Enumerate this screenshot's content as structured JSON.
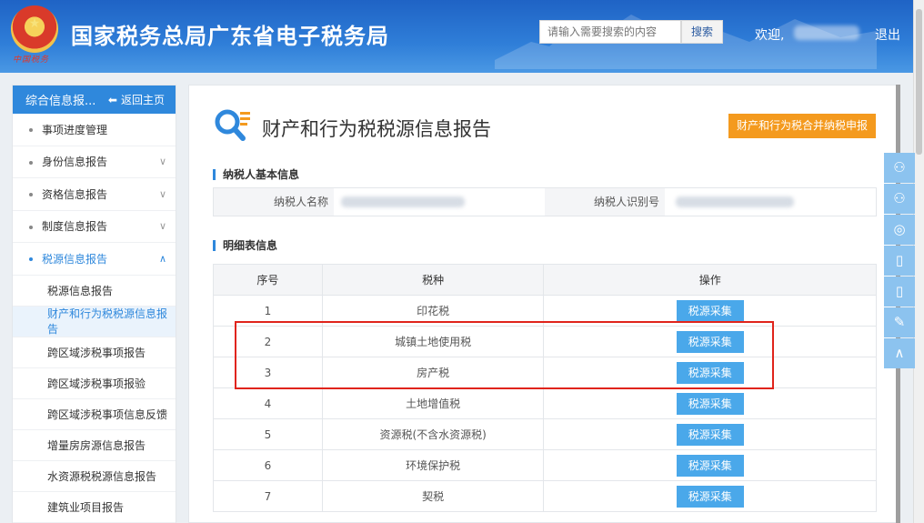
{
  "header": {
    "site_title": "国家税务总局广东省电子税务局",
    "emblem_text": "中国税务",
    "search_placeholder": "请输入需要搜索的内容",
    "search_button": "搜索",
    "welcome": "欢迎,",
    "logout": "退出"
  },
  "sidebar": {
    "title": "综合信息报...",
    "home_link": "返回主页",
    "items": [
      {
        "label": "事项进度管理",
        "expandable": false
      },
      {
        "label": "身份信息报告",
        "expandable": true,
        "expanded": false
      },
      {
        "label": "资格信息报告",
        "expandable": true,
        "expanded": false
      },
      {
        "label": "制度信息报告",
        "expandable": true,
        "expanded": false
      },
      {
        "label": "税源信息报告",
        "expandable": true,
        "expanded": true
      }
    ],
    "subitems": [
      {
        "label": "税源信息报告",
        "selected": false
      },
      {
        "label": "财产和行为税税源信息报告",
        "selected": true
      },
      {
        "label": "跨区域涉税事项报告",
        "selected": false
      },
      {
        "label": "跨区域涉税事项报验",
        "selected": false
      },
      {
        "label": "跨区域涉税事项信息反馈",
        "selected": false
      },
      {
        "label": "增量房房源信息报告",
        "selected": false
      },
      {
        "label": "水资源税税源信息报告",
        "selected": false
      },
      {
        "label": "建筑业项目报告",
        "selected": false
      }
    ]
  },
  "main": {
    "page_title": "财产和行为税税源信息报告",
    "merge_button": "财产和行为税合并纳税申报",
    "basic_info_title": "纳税人基本信息",
    "taxpayer_name_label": "纳税人名称",
    "taxpayer_id_label": "纳税人识别号",
    "detail_title": "明细表信息",
    "table": {
      "headers": [
        "序号",
        "税种",
        "操作"
      ],
      "action_label": "税源采集",
      "rows": [
        {
          "no": "1",
          "tax": "印花税"
        },
        {
          "no": "2",
          "tax": "城镇土地使用税"
        },
        {
          "no": "3",
          "tax": "房产税"
        },
        {
          "no": "4",
          "tax": "土地增值税"
        },
        {
          "no": "5",
          "tax": "资源税(不含水资源税)"
        },
        {
          "no": "6",
          "tax": "环境保护税"
        },
        {
          "no": "7",
          "tax": "契税"
        }
      ]
    }
  },
  "colors": {
    "header_blue": "#2f7ed8",
    "accent_blue": "#2f88dc",
    "merge_orange": "#f49a1e",
    "action_blue": "#4aa8ea",
    "highlight_red": "#e0241b"
  },
  "float_toolbar": [
    "wechat-icon",
    "wechat-icon",
    "weibo-icon",
    "mobile-icon",
    "mobile-icon",
    "edit-icon",
    "back-to-top-icon"
  ]
}
